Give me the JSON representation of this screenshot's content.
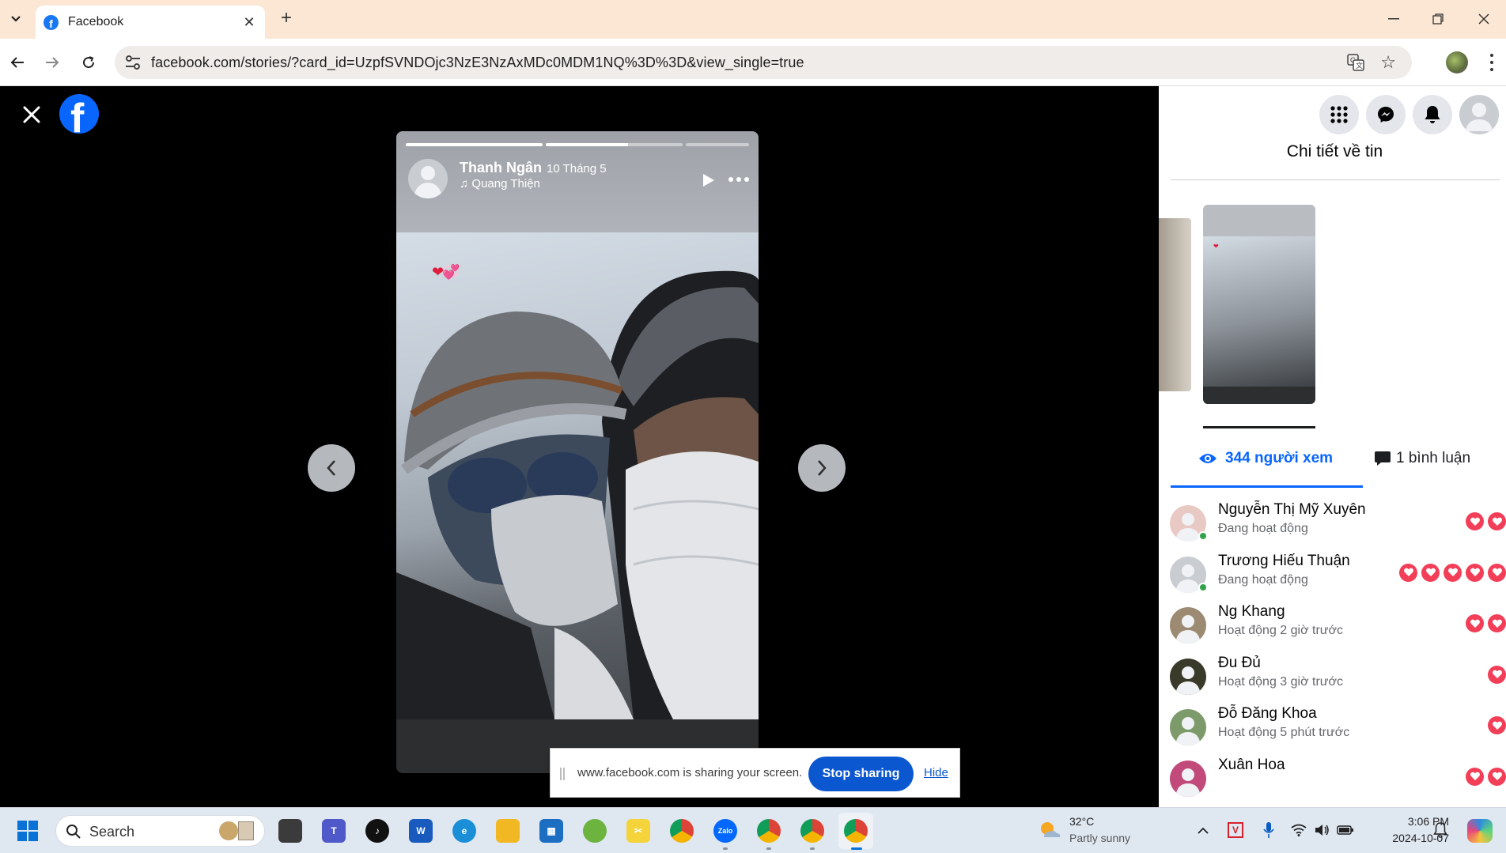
{
  "browser": {
    "tab_title": "Facebook",
    "url": "facebook.com/stories/?card_id=UzpfSVNDOjc3NzE3NzAxMDc0MDM1NQ%3D%3D&view_single=true"
  },
  "story": {
    "author": "Thanh Ngân",
    "date": "10 Tháng 5",
    "music": "Quang Thiện",
    "segments": [
      {
        "progress": 1.0
      },
      {
        "progress": 0.6
      },
      {
        "progress": 0.0
      }
    ]
  },
  "panel": {
    "title": "Chi tiết về tin",
    "views_tab": "344 người xem",
    "comments_tab": "1 bình luận",
    "viewers": [
      {
        "name": "Nguyễn Thị Mỹ Xuyên",
        "status": "Đang hoạt động",
        "online": true,
        "reactions": 2,
        "avatar_color": "#e8c9c3"
      },
      {
        "name": "Trương Hiếu Thuận",
        "status": "Đang hoạt động",
        "online": true,
        "reactions": 5,
        "avatar_color": "#c9ccd1"
      },
      {
        "name": "Ng Khang",
        "status": "Hoạt động 2 giờ trước",
        "online": false,
        "reactions": 2,
        "avatar_color": "#9c8a72"
      },
      {
        "name": "Đu Đủ",
        "status": "Hoạt động 3 giờ trước",
        "online": false,
        "reactions": 1,
        "avatar_color": "#3a3a2a"
      },
      {
        "name": "Đỗ Đăng Khoa",
        "status": "Hoạt động 5 phút trước",
        "online": false,
        "reactions": 1,
        "avatar_color": "#7c9a6a"
      },
      {
        "name": "Xuân Hoa",
        "status": "",
        "online": false,
        "reactions": 2,
        "avatar_color": "#c14a7a"
      }
    ]
  },
  "share_bar": {
    "message": "www.facebook.com is sharing your screen.",
    "stop_label": "Stop sharing",
    "hide_label": "Hide"
  },
  "taskbar": {
    "search_label": "Search",
    "weather_temp": "32°C",
    "weather_desc": "Partly sunny",
    "time": "3:06 PM",
    "date": "2024-10-07"
  }
}
